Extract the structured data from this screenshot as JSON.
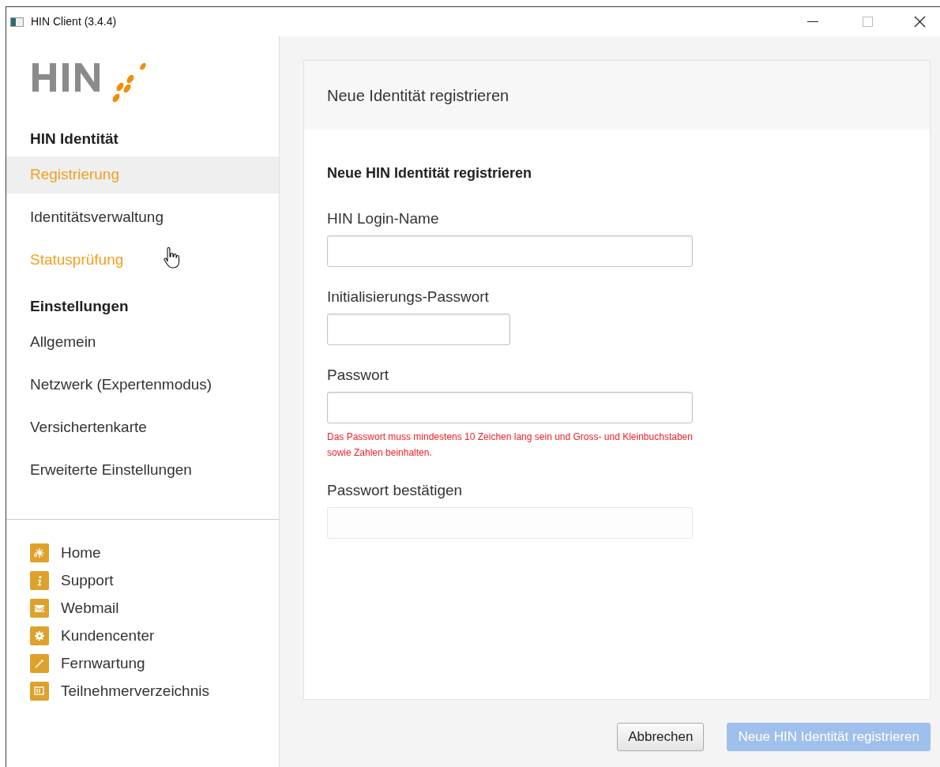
{
  "window": {
    "title": "HIN Client (3.4.4)"
  },
  "sidebar": {
    "sections": [
      {
        "heading": "HIN Identität",
        "items": [
          {
            "label": "Registrierung",
            "selected": true,
            "hovered": false
          },
          {
            "label": "Identitätsverwaltung",
            "selected": false,
            "hovered": false
          },
          {
            "label": "Statusprüfung",
            "selected": false,
            "hovered": true
          }
        ]
      },
      {
        "heading": "Einstellungen",
        "items": [
          {
            "label": "Allgemein",
            "selected": false,
            "hovered": false
          },
          {
            "label": "Netzwerk (Expertenmodus)",
            "selected": false,
            "hovered": false
          },
          {
            "label": "Versichertenkarte",
            "selected": false,
            "hovered": false
          },
          {
            "label": "Erweiterte Einstellungen",
            "selected": false,
            "hovered": false
          }
        ]
      }
    ],
    "links": [
      {
        "kind": "home",
        "label": "Home"
      },
      {
        "kind": "support",
        "label": "Support"
      },
      {
        "kind": "webmail",
        "label": "Webmail"
      },
      {
        "kind": "kundencenter",
        "label": "Kundencenter"
      },
      {
        "kind": "fernwartung",
        "label": "Fernwartung"
      },
      {
        "kind": "directory",
        "label": "Teilnehmerverzeichnis"
      }
    ]
  },
  "panel": {
    "title": "Neue Identität registrieren",
    "form_title": "Neue HIN Identität registrieren",
    "fields": [
      {
        "label": "HIN Login-Name",
        "kind": "wide",
        "disabled": false
      },
      {
        "label": "Initialisierungs-Passwort",
        "kind": "narrow",
        "disabled": false
      },
      {
        "label": "Passwort",
        "kind": "wide",
        "disabled": false,
        "hint": "Das Passwort muss mindestens 10 Zeichen lang sein und Gross- und Kleinbuchstaben sowie Zahlen beinhalten."
      },
      {
        "label": "Passwort bestätigen",
        "kind": "wide",
        "disabled": true
      }
    ]
  },
  "buttons": [
    {
      "label": "Abbrechen",
      "kind": "secondary",
      "disabled": false
    },
    {
      "label": "Neue HIN Identität registrieren",
      "kind": "primary",
      "disabled": true
    }
  ]
}
